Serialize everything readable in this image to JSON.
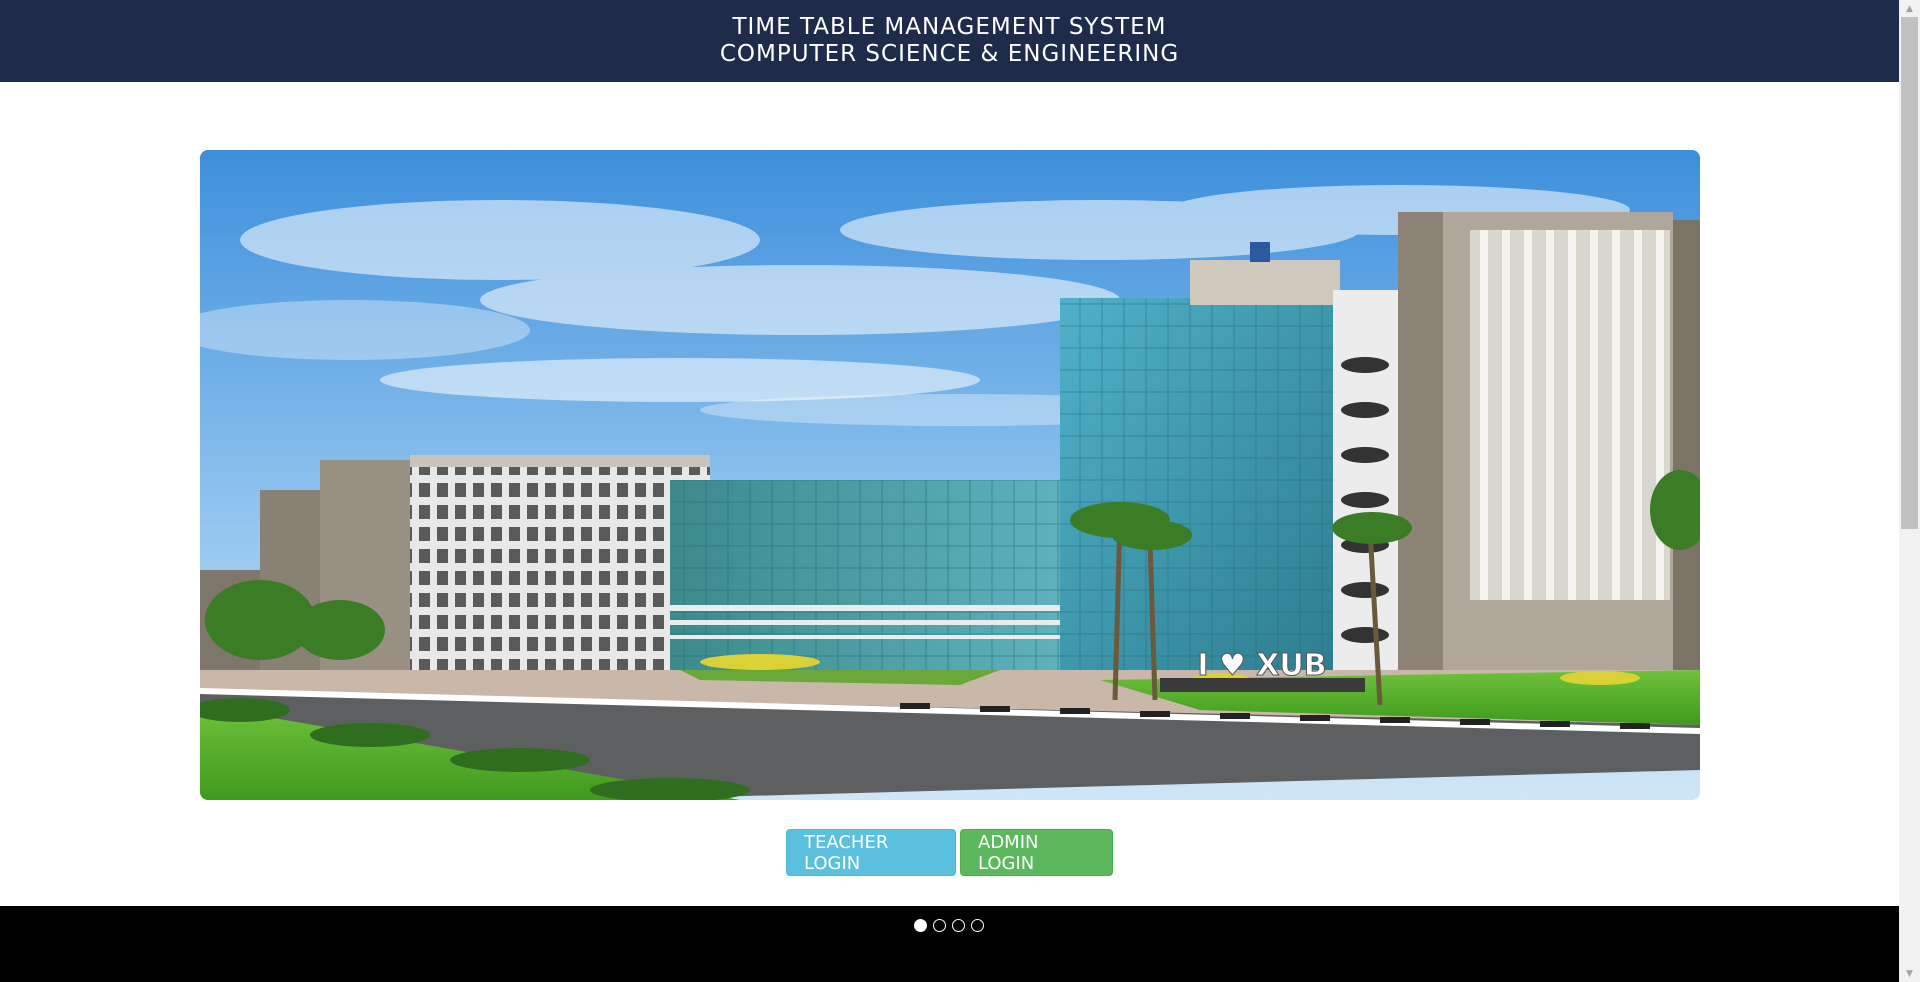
{
  "header": {
    "title_line1": "TIME TABLE MANAGEMENT SYSTEM",
    "title_line2": "COMPUTER SCIENCE & ENGINEERING"
  },
  "hero": {
    "sign_text": "I ♥ XUB"
  },
  "buttons": {
    "teacher_login": "TEACHER LOGIN",
    "admin_login": "ADMIN LOGIN"
  },
  "carousel": {
    "slide_count": 4,
    "active_index": 0
  },
  "colors": {
    "header_bg": "#1f2b4b",
    "teacher_btn": "#5bc0de",
    "admin_btn": "#5cb85c",
    "footer_bg": "#000000"
  }
}
